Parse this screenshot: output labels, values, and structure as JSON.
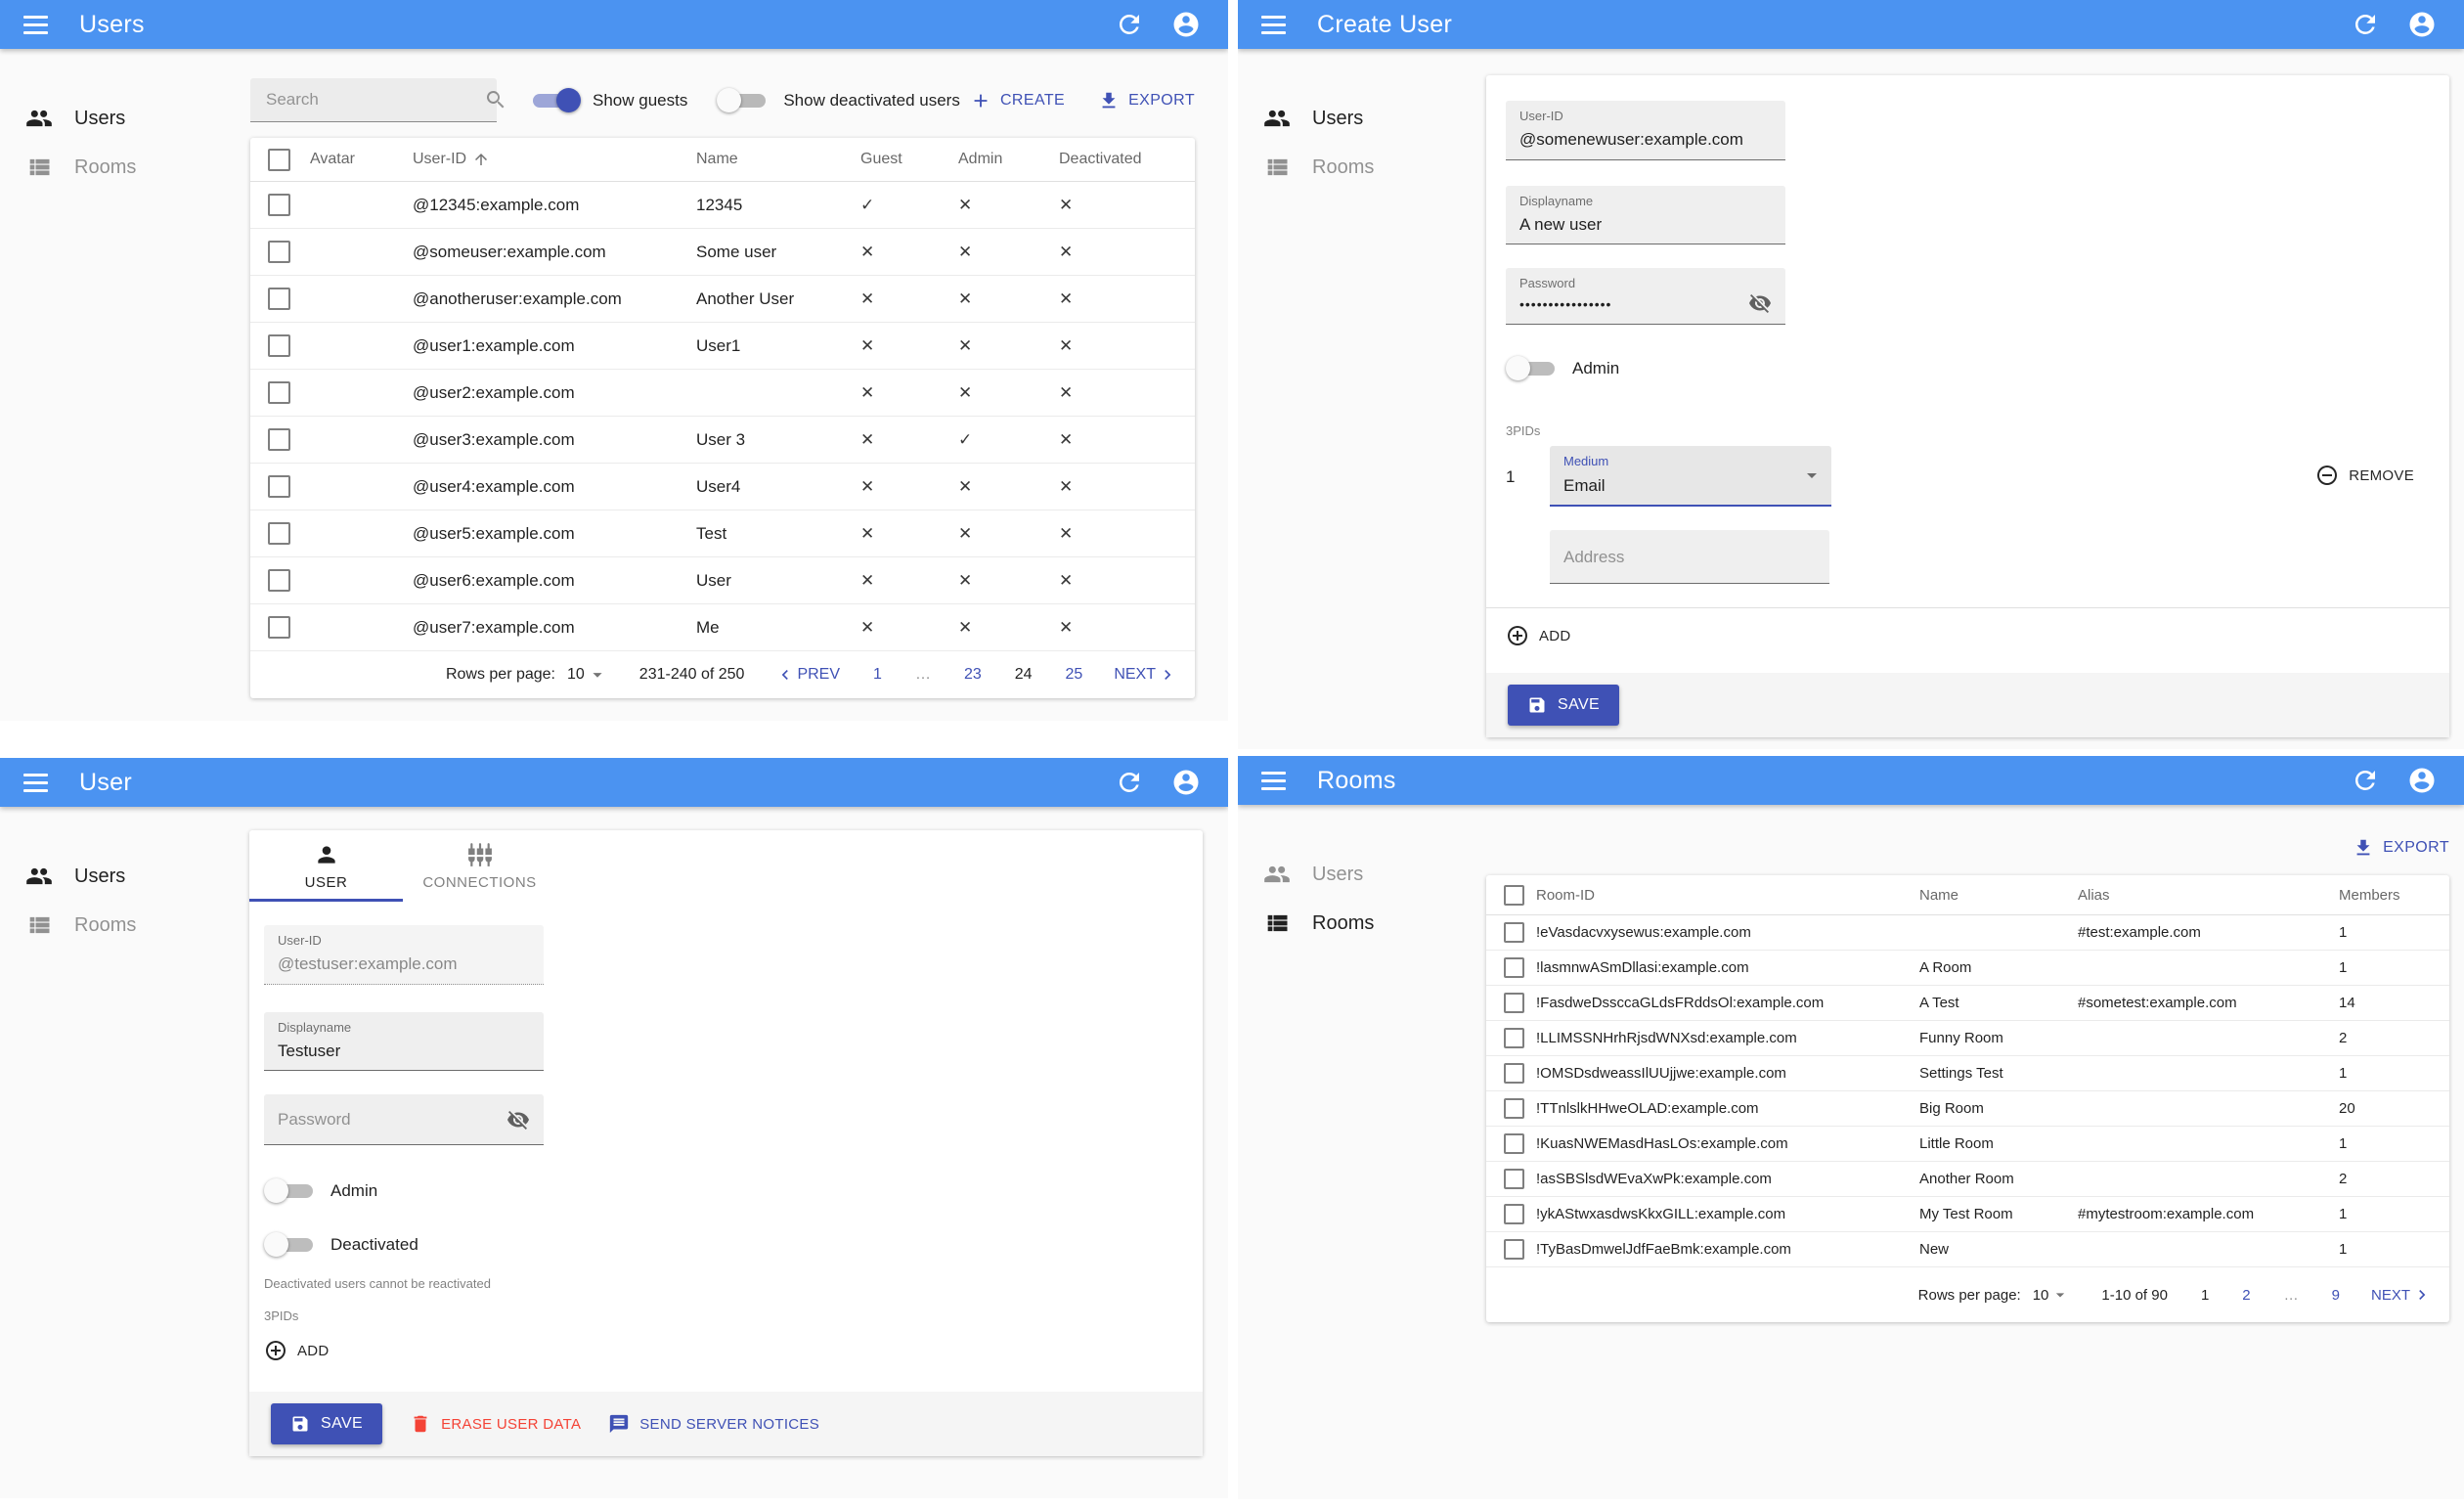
{
  "colors": {
    "app_bar": "#4b93f1",
    "primary": "#3f51b5",
    "danger": "#f44336",
    "background": "#fafafa"
  },
  "glyphs": {
    "check": "✓",
    "cross": "✕"
  },
  "panels": {
    "users_list": {
      "app_bar_title": "Users",
      "sidebar": {
        "users": "Users",
        "rooms": "Rooms"
      },
      "toolbar": {
        "search_placeholder": "Search",
        "show_guests_label": "Show guests",
        "show_guests_on": true,
        "show_deactivated_label": "Show deactivated users",
        "show_deactivated_on": false,
        "create_label": "CREATE",
        "export_label": "EXPORT"
      },
      "table": {
        "headers": {
          "avatar": "Avatar",
          "user_id": "User-ID",
          "name": "Name",
          "guest": "Guest",
          "admin": "Admin",
          "deactivated": "Deactivated"
        },
        "rows": [
          {
            "user_id": "@12345:example.com",
            "name": "12345",
            "guest": true,
            "admin": false,
            "deactivated": false
          },
          {
            "user_id": "@someuser:example.com",
            "name": "Some user",
            "guest": false,
            "admin": false,
            "deactivated": false
          },
          {
            "user_id": "@anotheruser:example.com",
            "name": "Another User",
            "guest": false,
            "admin": false,
            "deactivated": false
          },
          {
            "user_id": "@user1:example.com",
            "name": "User1",
            "guest": false,
            "admin": false,
            "deactivated": false
          },
          {
            "user_id": "@user2:example.com",
            "name": "",
            "guest": false,
            "admin": false,
            "deactivated": false
          },
          {
            "user_id": "@user3:example.com",
            "name": "User 3",
            "guest": false,
            "admin": true,
            "deactivated": false
          },
          {
            "user_id": "@user4:example.com",
            "name": "User4",
            "guest": false,
            "admin": false,
            "deactivated": false
          },
          {
            "user_id": "@user5:example.com",
            "name": "Test",
            "guest": false,
            "admin": false,
            "deactivated": false
          },
          {
            "user_id": "@user6:example.com",
            "name": "User",
            "guest": false,
            "admin": false,
            "deactivated": false
          },
          {
            "user_id": "@user7:example.com",
            "name": "Me",
            "guest": false,
            "admin": false,
            "deactivated": false
          }
        ]
      },
      "pagination": {
        "rows_per_page_label": "Rows per page:",
        "rows_per_page_value": "10",
        "range": "231-240 of 250",
        "prev_label": "PREV",
        "next_label": "NEXT",
        "pages": [
          {
            "label": "1"
          },
          {
            "label": "…",
            "ellipsis": true
          },
          {
            "label": "23"
          },
          {
            "label": "24",
            "current": true
          },
          {
            "label": "25"
          }
        ]
      }
    },
    "create_user": {
      "app_bar_title": "Create User",
      "sidebar": {
        "users": "Users",
        "rooms": "Rooms"
      },
      "form": {
        "user_id": {
          "label": "User-ID",
          "value": "@somenewuser:example.com"
        },
        "displayname": {
          "label": "Displayname",
          "value": "A new user"
        },
        "password": {
          "label": "Password",
          "value": "••••••••••••••••"
        },
        "admin_label": "Admin",
        "threepids_label": "3PIDs",
        "threepid_index": "1",
        "medium": {
          "label": "Medium",
          "value": "Email"
        },
        "remove_label": "REMOVE",
        "address_placeholder": "Address",
        "add_label": "ADD",
        "save_label": "SAVE"
      }
    },
    "user_detail": {
      "app_bar_title": "User",
      "sidebar": {
        "users": "Users",
        "rooms": "Rooms"
      },
      "tabs": {
        "user": "USER",
        "connections": "CONNECTIONS"
      },
      "form": {
        "user_id": {
          "label": "User-ID",
          "value": "@testuser:example.com"
        },
        "displayname": {
          "label": "Displayname",
          "value": "Testuser"
        },
        "password_placeholder": "Password",
        "admin_label": "Admin",
        "deactivated_label": "Deactivated",
        "deactivated_helper": "Deactivated users cannot be reactivated",
        "threepids_label": "3PIDs",
        "add_label": "ADD"
      },
      "actions": {
        "save_label": "SAVE",
        "erase_label": "ERASE USER DATA",
        "notices_label": "SEND SERVER NOTICES"
      }
    },
    "rooms_list": {
      "app_bar_title": "Rooms",
      "sidebar": {
        "users": "Users",
        "rooms": "Rooms"
      },
      "export_label": "EXPORT",
      "table": {
        "headers": {
          "room_id": "Room-ID",
          "name": "Name",
          "alias": "Alias",
          "members": "Members"
        },
        "rows": [
          {
            "room_id": "!eVasdacvxysewus:example.com",
            "name": "",
            "alias": "#test:example.com",
            "members": "1"
          },
          {
            "room_id": "!lasmnwASmDllasi:example.com",
            "name": "A Room",
            "alias": "",
            "members": "1"
          },
          {
            "room_id": "!FasdweDssccaGLdsFRddsOl:example.com",
            "name": "A Test",
            "alias": "#sometest:example.com",
            "members": "14"
          },
          {
            "room_id": "!LLIMSSNHrhRjsdWNXsd:example.com",
            "name": "Funny Room",
            "alias": "",
            "members": "2"
          },
          {
            "room_id": "!OMSDsdweassIlUUjjwe:example.com",
            "name": "Settings Test",
            "alias": "",
            "members": "1"
          },
          {
            "room_id": "!TTnlslkHHweOLAD:example.com",
            "name": "Big Room",
            "alias": "",
            "members": "20"
          },
          {
            "room_id": "!KuasNWEMasdHasLOs:example.com",
            "name": "Little Room",
            "alias": "",
            "members": "1"
          },
          {
            "room_id": "!asSBSlsdWEvaXwPk:example.com",
            "name": "Another Room",
            "alias": "",
            "members": "2"
          },
          {
            "room_id": "!ykAStwxasdwsKkxGILL:example.com",
            "name": "My Test Room",
            "alias": "#mytestroom:example.com",
            "members": "1"
          },
          {
            "room_id": "!TyBasDmwelJdfFaeBmk:example.com",
            "name": "New",
            "alias": "",
            "members": "1"
          }
        ]
      },
      "pagination": {
        "rows_per_page_label": "Rows per page:",
        "rows_per_page_value": "10",
        "range": "1-10 of 90",
        "next_label": "NEXT",
        "pages": [
          {
            "label": "1",
            "current": true
          },
          {
            "label": "2"
          },
          {
            "label": "…",
            "ellipsis": true
          },
          {
            "label": "9"
          }
        ]
      }
    }
  }
}
